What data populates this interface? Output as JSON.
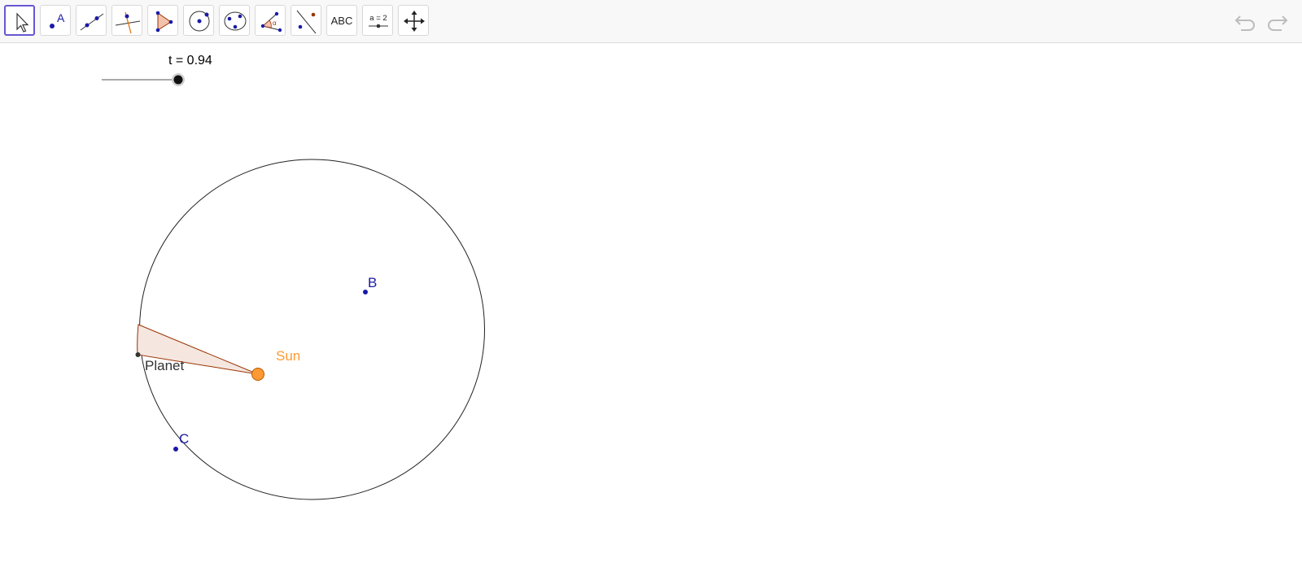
{
  "toolbar": {
    "tools": [
      {
        "name": "move-tool",
        "icon": "arrow-cursor-icon"
      },
      {
        "name": "point-tool",
        "icon": "point-icon",
        "text": "A"
      },
      {
        "name": "line-tool",
        "icon": "line-through-two-points-icon"
      },
      {
        "name": "perpendicular-line-tool",
        "icon": "perpendicular-line-icon"
      },
      {
        "name": "polygon-tool",
        "icon": "polygon-icon"
      },
      {
        "name": "circle-center-point-tool",
        "icon": "circle-with-center-icon"
      },
      {
        "name": "ellipse-tool",
        "icon": "ellipse-icon"
      },
      {
        "name": "angle-tool",
        "icon": "angle-icon",
        "text": "α"
      },
      {
        "name": "reflect-tool",
        "icon": "reflect-about-line-icon"
      },
      {
        "name": "text-tool",
        "text": "ABC"
      },
      {
        "name": "slider-tool",
        "icon": "slider-icon",
        "text": "a = 2"
      },
      {
        "name": "move-graphics-view-tool",
        "icon": "move-arrows-icon"
      }
    ],
    "undo": {
      "icon": "undo-icon"
    },
    "redo": {
      "icon": "redo-icon"
    }
  },
  "slider": {
    "label": "t = 0.94",
    "value": 0.94
  },
  "points": {
    "B": {
      "label": "B"
    },
    "C": {
      "label": "C"
    },
    "Planet": {
      "label": "Planet"
    },
    "Sun": {
      "label": "Sun"
    }
  },
  "colors": {
    "accent": "#6557d2",
    "point_blue": "#1a1aa6",
    "sun_orange": "#ff9933",
    "sector_fill": "#f5e6e0",
    "sector_stroke": "#993300"
  }
}
